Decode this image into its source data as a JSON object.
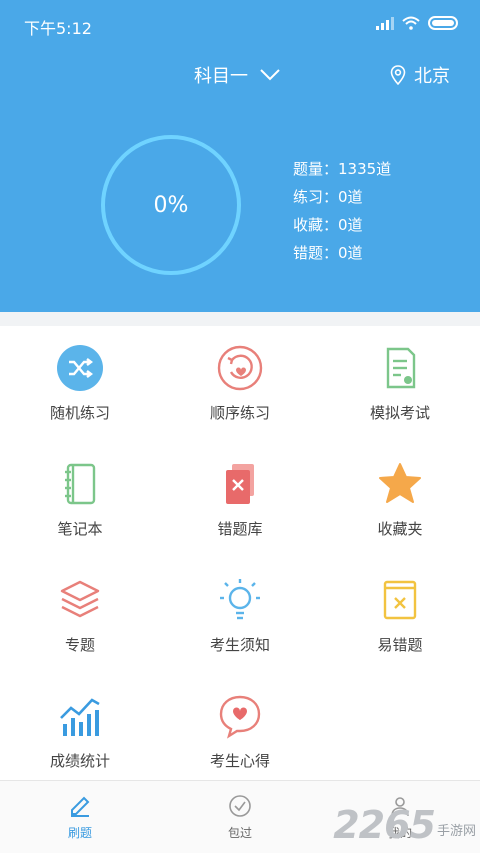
{
  "status": {
    "time": "下午5:12"
  },
  "header": {
    "subject": "科目一",
    "city": "北京"
  },
  "progress": {
    "text": "0%",
    "value": 0
  },
  "stats": {
    "total": "题量：1335道",
    "practice": "练习：0道",
    "favorites": "收藏：0道",
    "wrong": "错题：0道"
  },
  "menu": [
    {
      "label": "随机练习",
      "icon": "shuffle-icon"
    },
    {
      "label": "顺序练习",
      "icon": "sequence-icon"
    },
    {
      "label": "模拟考试",
      "icon": "exam-icon"
    },
    {
      "label": "笔记本",
      "icon": "notebook-icon"
    },
    {
      "label": "错题库",
      "icon": "wrong-bank-icon"
    },
    {
      "label": "收藏夹",
      "icon": "star-icon"
    },
    {
      "label": "专题",
      "icon": "layers-icon"
    },
    {
      "label": "考生须知",
      "icon": "bulb-icon"
    },
    {
      "label": "易错题",
      "icon": "error-book-icon"
    },
    {
      "label": "成绩统计",
      "icon": "chart-icon"
    },
    {
      "label": "考生心得",
      "icon": "heart-chat-icon"
    }
  ],
  "tabs": [
    {
      "label": "刷题",
      "icon": "edit-icon",
      "active": true
    },
    {
      "label": "包过",
      "icon": "check-icon",
      "active": false
    },
    {
      "label": "我的",
      "icon": "user-icon",
      "active": false
    }
  ],
  "watermark": {
    "big": "2265",
    "small": "手游网"
  },
  "colors": {
    "header": "#4aa8e8",
    "ring": "#6fd3ff",
    "active_tab": "#3a9be0"
  }
}
